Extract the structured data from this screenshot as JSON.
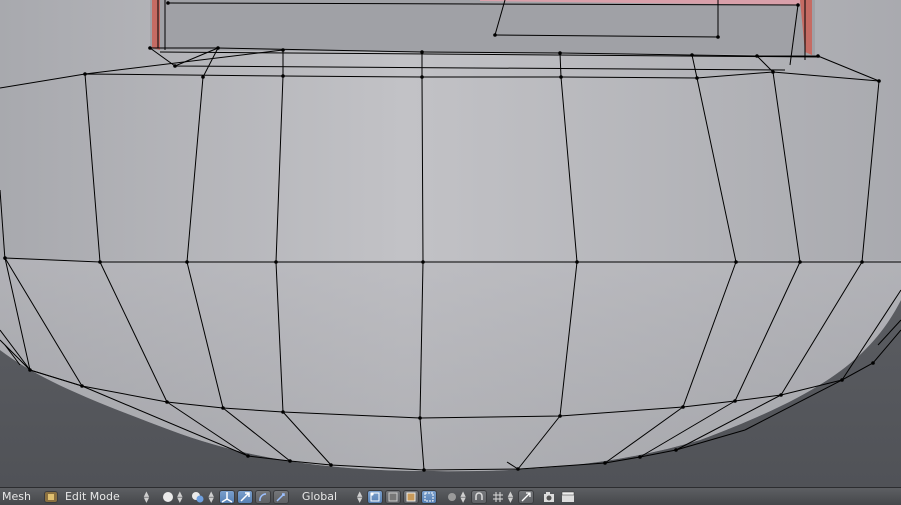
{
  "header": {
    "editor_label": "Mesh",
    "mode_label": "Edit Mode",
    "orientation_label": "Global"
  },
  "icons": [
    "mode-icon",
    "shading-solid-icon",
    "pivot-icon",
    "manipulator-toggle-icon",
    "translate-icon",
    "rotate-icon",
    "scale-icon",
    "layer-icon",
    "vertex-select-icon",
    "edge-select-icon",
    "face-select-icon",
    "limit-selection-icon",
    "proportional-edit-icon",
    "snap-icon",
    "snap-target-icon",
    "render-icon",
    "render-animation-icon"
  ],
  "colors": {
    "mesh_surface": "#b9b9bf",
    "wire": "#000000",
    "accent_blue": "#5680b4",
    "frame_red": "#c56b63"
  }
}
